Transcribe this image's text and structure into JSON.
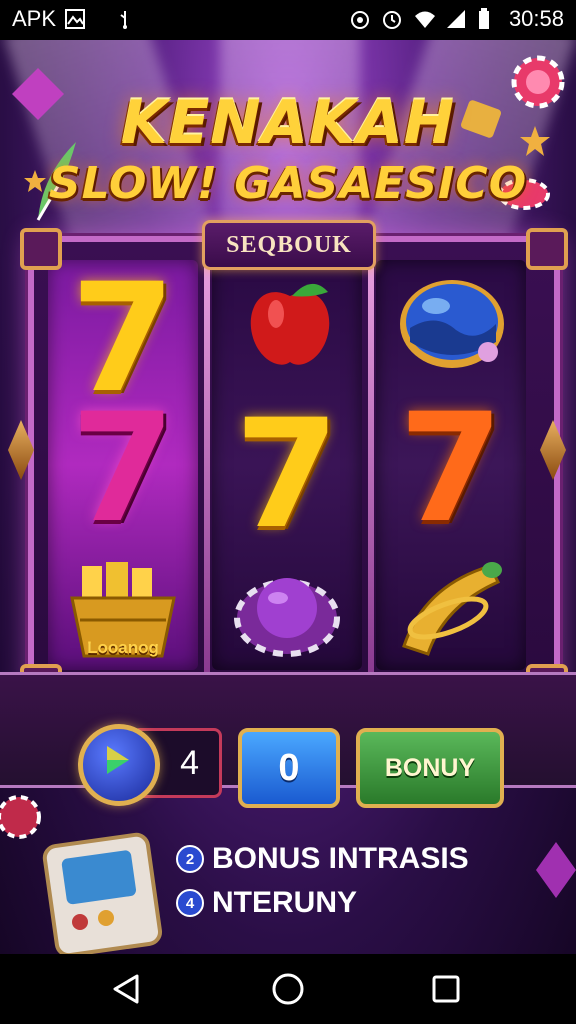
{
  "status_bar": {
    "left_text": "APK",
    "time": "30:58",
    "icons": [
      "image-icon",
      "usb-icon",
      "alarm-icon",
      "clock-icon",
      "wifi-icon",
      "signal-icon",
      "battery-icon"
    ]
  },
  "game": {
    "title_line1": "KENAKAH",
    "title_line2": "SLOW! GASAESICO",
    "reel_plaque": "SEQBOUK",
    "reels": [
      [
        "seven-yellow",
        "seven-pink",
        "gold-bucket"
      ],
      [
        "red-apple",
        "seven-yellow",
        "purple-chip"
      ],
      [
        "blue-orb",
        "seven-orange",
        "golden-horn"
      ]
    ],
    "bucket_label": "Looanog"
  },
  "controls": {
    "play_icon": "play-icon",
    "count_value": "4",
    "zero_value": "0",
    "bonus_label": "BONUY"
  },
  "bottom_list": {
    "items": [
      {
        "number": "2",
        "label": "BONUS INTRASIS"
      },
      {
        "number": "4",
        "label": "NTERUNY"
      }
    ]
  },
  "nav_bar": {
    "back_icon": "back-icon",
    "home_icon": "home-icon",
    "recents_icon": "recents-icon"
  },
  "colors": {
    "title_gold": "#ffd23a",
    "frame_pink": "#c46ac8",
    "bonus_green": "#2a7a2a",
    "zero_blue": "#1a5ad0"
  }
}
